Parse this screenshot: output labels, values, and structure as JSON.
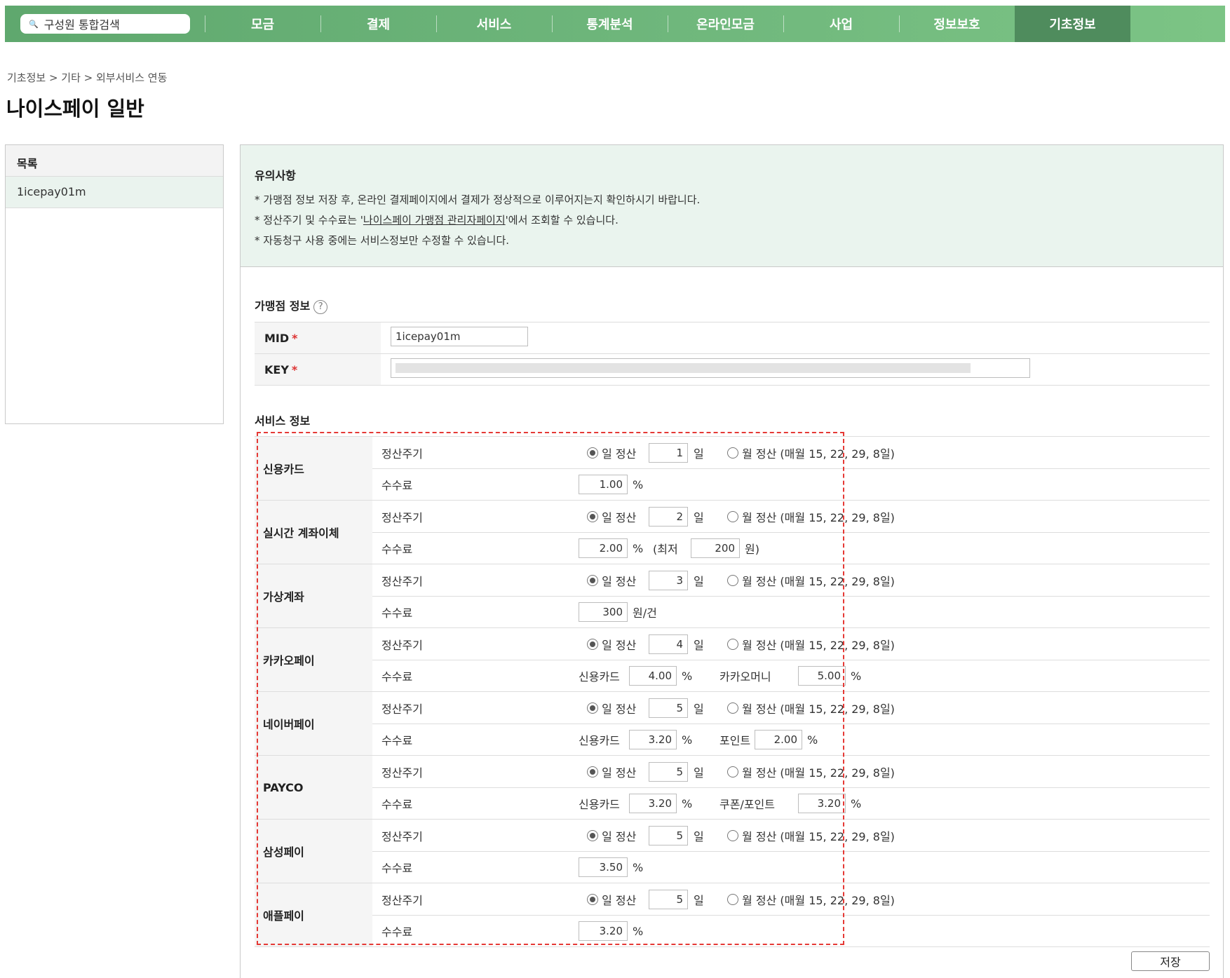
{
  "search": {
    "placeholder": "구성원 통합검색"
  },
  "nav": {
    "items": [
      "모금",
      "결제",
      "서비스",
      "통계분석",
      "온라인모금",
      "사업",
      "정보보호",
      "기초정보"
    ],
    "active": "기초정보"
  },
  "breadcrumb": "기초정보 > 기타 > 외부서비스 연동",
  "page_title": "나이스페이 일반",
  "list": {
    "header": "목록",
    "items": [
      "1icepay01m"
    ]
  },
  "notice": {
    "title": "유의사항",
    "line1": "* 가맹점 정보 저장 후, 온라인 결제페이지에서 결제가 정상적으로 이루어지는지 확인하시기 바랍니다.",
    "line2_pre": "* 정산주기 및 수수료는 '",
    "line2_link": "나이스페이 가맹점 관리자페이지",
    "line2_post": "'에서 조회할 수 있습니다.",
    "line3": "* 자동청구 사용 중에는 서비스정보만 수정할 수 있습니다."
  },
  "merchant": {
    "title": "가맹점 정보",
    "mid_label": "MID",
    "mid_value": "1icepay01m",
    "key_label": "KEY",
    "required_mark": "*"
  },
  "service": {
    "title": "서비스 정보",
    "cycle_label": "정산주기",
    "fee_label": "수수료",
    "daily_label": "일 정산",
    "day_unit": "일",
    "monthly_label": "월 정산 (매월 15, 22, 29, 8일)",
    "percent": "%",
    "items": [
      {
        "name": "신용카드",
        "days": "1",
        "fee": "1.00",
        "fee_unit": "%"
      },
      {
        "name": "실시간 계좌이체",
        "days": "2",
        "fee": "2.00",
        "fee_unit": "%",
        "min_pre": "(최저",
        "min_value": "200",
        "min_post": "원)"
      },
      {
        "name": "가상계좌",
        "days": "3",
        "fee": "300",
        "fee_unit": "원/건"
      },
      {
        "name": "카카오페이",
        "days": "4",
        "card_label": "신용카드",
        "card_fee": "4.00",
        "extra_label": "카카오머니",
        "extra_fee": "5.00"
      },
      {
        "name": "네이버페이",
        "days": "5",
        "card_label": "신용카드",
        "card_fee": "3.20",
        "extra_label": "포인트",
        "extra_fee": "2.00"
      },
      {
        "name": "PAYCO",
        "days": "5",
        "card_label": "신용카드",
        "card_fee": "3.20",
        "extra_label": "쿠폰/포인트",
        "extra_fee": "3.20"
      },
      {
        "name": "삼성페이",
        "days": "5",
        "fee": "3.50",
        "fee_unit": "%"
      },
      {
        "name": "애플페이",
        "days": "5",
        "fee": "3.20",
        "fee_unit": "%"
      }
    ]
  },
  "save_label": "저장"
}
